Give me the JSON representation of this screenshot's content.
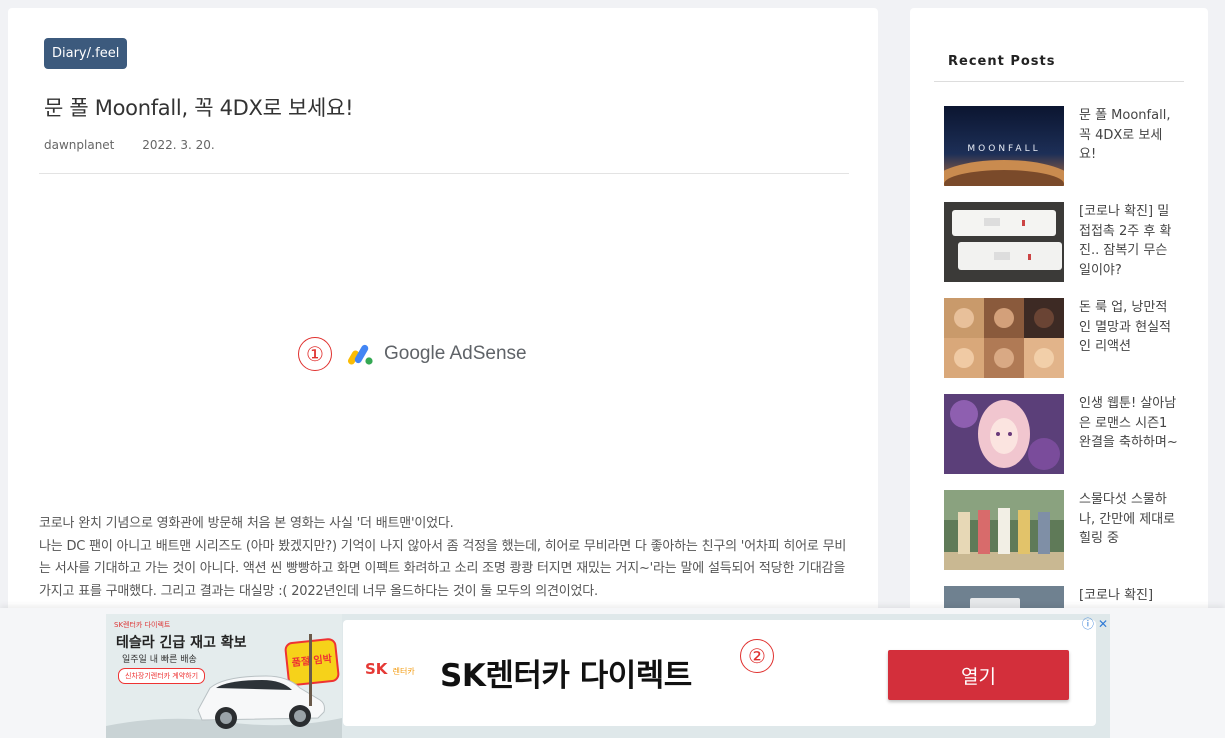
{
  "post": {
    "category": "Diary/.feel",
    "title": "문 폴 Moonfall, 꼭 4DX로 보세요!",
    "author": "dawnplanet",
    "date": "2022. 3. 20."
  },
  "ad_slot": {
    "marker": "①",
    "logo_text": "Google AdSense"
  },
  "article": {
    "p1": "코로나 완치 기념으로 영화관에 방문해 처음 본 영화는 사실 '더 배트맨'이었다.",
    "p2": "나는 DC 팬이 아니고 배트맨 시리즈도 (아마 봤겠지만?) 기억이 나지 않아서 좀 걱정을 했는데, 히어로 무비라면 다 좋아하는 친구의 '어차피 히어로 무비는 서사를 기대하고 가는 것이 아니다. 액션 씬 빵빵하고 화면 이펙트 화려하고 소리 조명 쾅쾅 터지면 재밌는 거지~'라는 말에 설득되어 적당한 기대감을 가지고 표를 구매했다. 그리고 결과는 대실망 :( 2022년인데 너무 올드하다는 것이 둘 모두의 의견이었다."
  },
  "sidebar": {
    "title": "Recent Posts",
    "posts": [
      {
        "label": "문 폴 Moonfall, 꼭 4DX로 보세요!",
        "thumb_text": "MOONFALL"
      },
      {
        "label": "[코로나 확진] 밀접접촉 2주 후 확진.. 잠복기 무슨 일이야?"
      },
      {
        "label": "돈 룩 업, 낭만적인 멸망과 현실적인 리액션"
      },
      {
        "label": "인생 웹툰! 살아남은 로맨스 시즌1 완결을 축하하며~"
      },
      {
        "label": "스물다섯 스물하나, 간만에 제대로 힐링 중"
      },
      {
        "label": "[코로나 확진]"
      }
    ]
  },
  "ad_banner": {
    "brand_small": "SK렌터카 다이렉트",
    "headline": "테슬라 긴급 재고 확보",
    "subline": "일주일 내 빠른 배송",
    "pill": "신차장기렌터카 계약하기",
    "sign": "품절 임박",
    "sk_logo": "SK",
    "sk_logo_sub": "렌터카",
    "title": "SK렌터카 다이렉트",
    "marker": "②",
    "button": "열기",
    "info_icon": "ⓘ",
    "close_icon": "✕"
  },
  "colors": {
    "badge": "#3c5a7d",
    "marker": "#e0312f",
    "button": "#d32f3b"
  }
}
